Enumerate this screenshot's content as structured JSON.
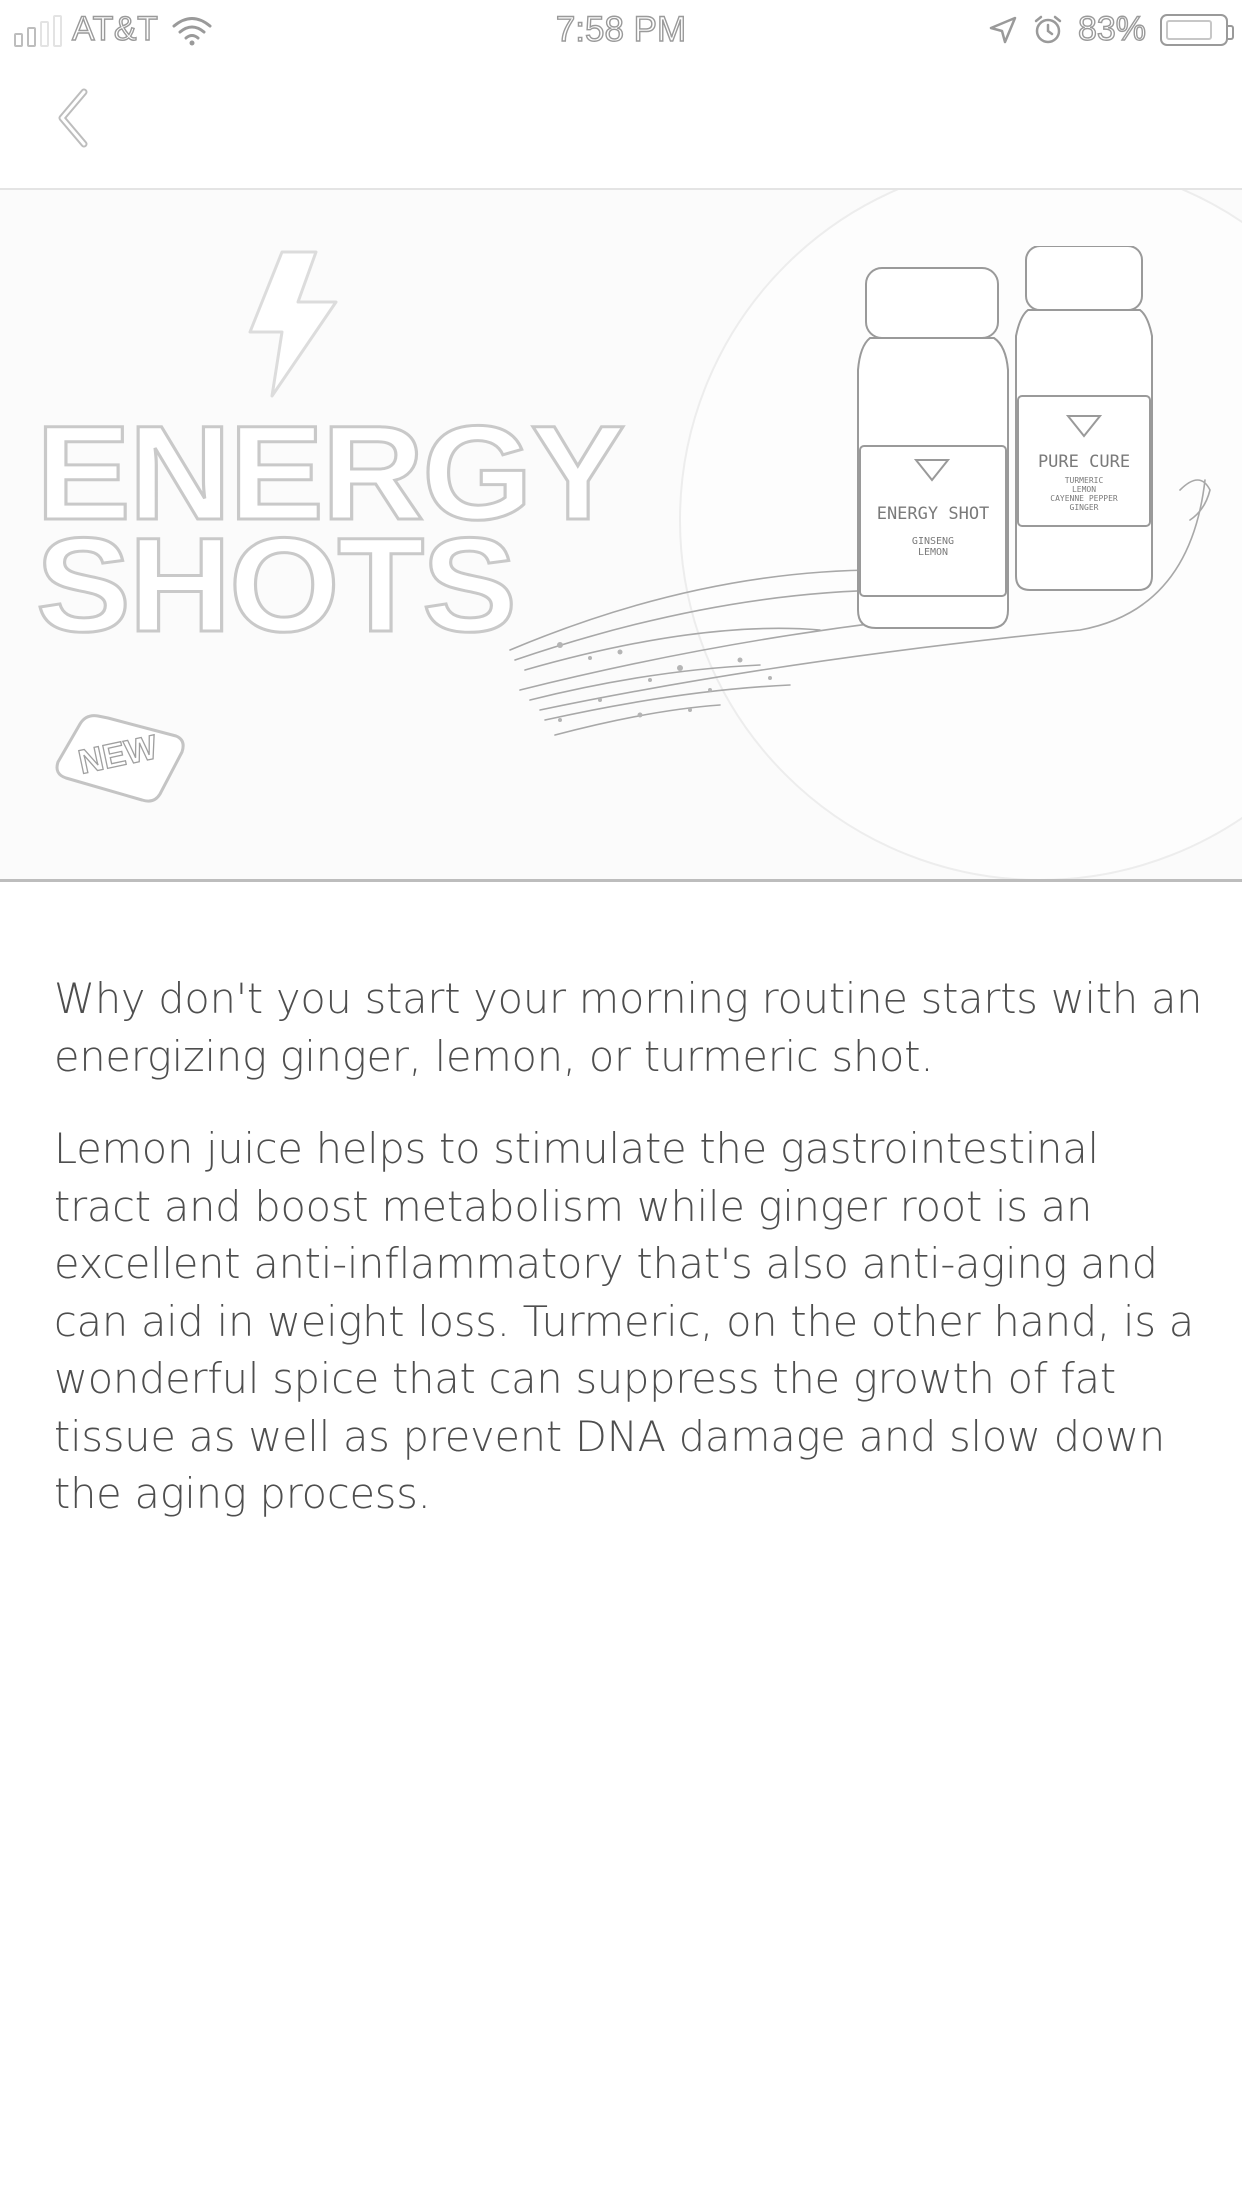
{
  "status_bar": {
    "carrier": "AT&T",
    "time": "7:58 PM",
    "battery_percent": "83%",
    "battery_level": 0.83,
    "icons": [
      "signal-icon",
      "wifi-icon",
      "location-icon",
      "alarm-icon",
      "battery-icon"
    ]
  },
  "nav": {
    "back_icon": "chevron-left-icon"
  },
  "hero": {
    "title_line1": "ENERGY",
    "title_line2": "SHOTS",
    "badge": "NEW",
    "bolt_icon": "lightning-bolt-icon",
    "bottle_left": {
      "label": "ENERGY SHOT",
      "line1": "GINSENG",
      "line2": "LEMON"
    },
    "bottle_right": {
      "label": "PURE CURE",
      "line1": "TURMERIC",
      "line2": "LEMON",
      "line3": "CAYENNE PEPPER",
      "line4": "GINGER"
    }
  },
  "content": {
    "paragraph1": "Why don't you start your morning routine starts with an energizing ginger, lemon, or turmeric shot.",
    "paragraph2": "Lemon juice helps to stimulate the gastrointestinal tract and boost metabolism while ginger root is an excellent anti-inflammatory that's also anti-aging and can aid in weight loss. Turmeric, on the other hand, is a wonderful spice that can suppress the growth of fat tissue as well as prevent DNA damage and slow down the aging process."
  },
  "colors": {
    "outline": "#c9c9c9",
    "text": "#4e4e4e",
    "divider": "#bdbdbd"
  }
}
